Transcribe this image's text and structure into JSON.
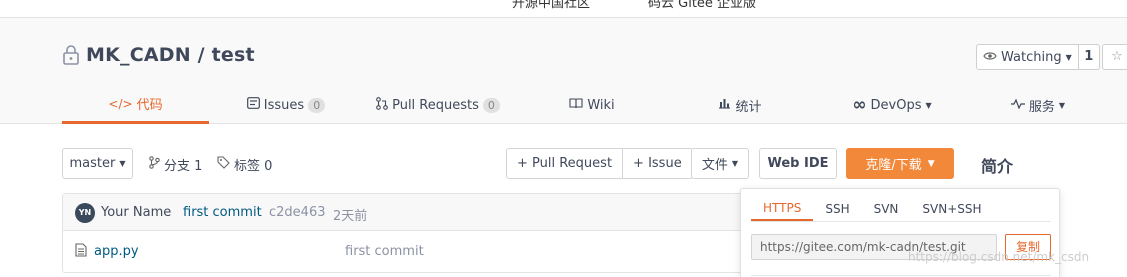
{
  "top_strip": {
    "fragment_a": "开源中国社区",
    "fragment_b": "码云 Gitee 企业版"
  },
  "repo": {
    "title": "MK_CADN / test",
    "watch_label": "Watching",
    "watch_count": "1",
    "star_icon": "star-icon"
  },
  "tabs": [
    {
      "label": "代码",
      "icon": "code-icon",
      "active": true
    },
    {
      "label": "Issues",
      "badge": "0",
      "icon": "issue-icon"
    },
    {
      "label": "Pull Requests",
      "badge": "0",
      "icon": "pull-request-icon"
    },
    {
      "label": "Wiki",
      "icon": "book-icon"
    },
    {
      "label": "统计",
      "icon": "bar-chart-icon"
    },
    {
      "label": "DevOps",
      "icon": "infinity-icon",
      "has_dropdown": true
    },
    {
      "label": "服务",
      "icon": "pulse-icon",
      "has_dropdown": true
    }
  ],
  "toolbar": {
    "branch": "master",
    "branches": "分支 1",
    "tags": "标签 0",
    "pull_request_btn": "+ Pull Request",
    "issue_btn": "+ Issue",
    "file_btn": "文件",
    "web_ide_btn": "Web IDE",
    "clone_btn": "克隆/下载",
    "intro_heading": "简介"
  },
  "commit": {
    "avatar_initials": "YN",
    "author": "Your Name",
    "message": "first commit",
    "hash": "c2de463",
    "time": "2天前"
  },
  "files": [
    {
      "name": "app.py",
      "commit": "first commit"
    }
  ],
  "clone_panel": {
    "tabs": [
      "HTTPS",
      "SSH",
      "SVN",
      "SVN+SSH"
    ],
    "active_tab": "HTTPS",
    "url": "https://gitee.com/mk-cadn/test.git",
    "copy_btn": "复制"
  },
  "watermark": "https://blog.csdn.net/mk_csdn",
  "colors": {
    "accent": "#e6682d",
    "clone_button": "#f2883a",
    "link": "#005980",
    "text": "#40485b"
  }
}
